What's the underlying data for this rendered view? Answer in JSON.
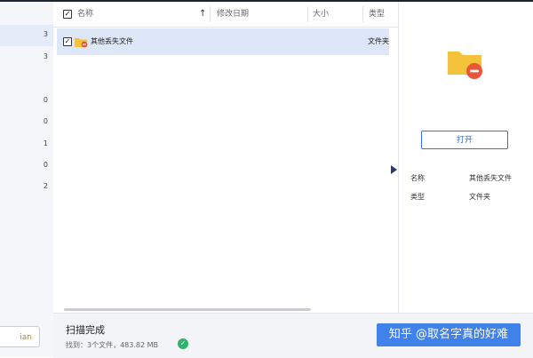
{
  "sidebar": {
    "counts": [
      "3",
      "3",
      "0",
      "0",
      "1",
      "0",
      "2"
    ],
    "button_label": "ian"
  },
  "list": {
    "headers": {
      "name": "名称",
      "sort_arrow": "↑",
      "modified": "修改日期",
      "size": "大小",
      "type": "类型"
    },
    "rows": [
      {
        "name": "其他丢失文件",
        "type": "文件夹",
        "checked": true
      }
    ]
  },
  "detail": {
    "open_label": "打开",
    "fields": [
      {
        "label": "名称",
        "value": "其他丢失文件"
      },
      {
        "label": "类型",
        "value": "文件夹"
      }
    ]
  },
  "status": {
    "title": "扫描完成",
    "found": "找到：3个文件，483.82 MB"
  },
  "watermark": "知乎 @取名字真的好难",
  "colors": {
    "accent": "#2f62c9",
    "folder": "#f5c23c",
    "badge": "#e8563a",
    "success": "#2fb36a"
  }
}
